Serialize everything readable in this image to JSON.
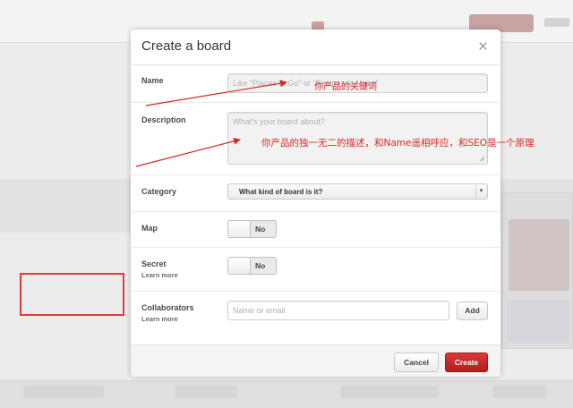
{
  "modal": {
    "title": "Create a board",
    "close_glyph": "×"
  },
  "form": {
    "name": {
      "label": "Name",
      "placeholder": "Like “Places to Go” or “Recipes to Make”"
    },
    "description": {
      "label": "Description",
      "placeholder": "What’s your board about?"
    },
    "category": {
      "label": "Category",
      "selected": "What kind of board is it?"
    },
    "map": {
      "label": "Map",
      "toggle": "No"
    },
    "secret": {
      "label": "Secret",
      "learn_more": "Learn more",
      "toggle": "No"
    },
    "collaborators": {
      "label": "Collaborators",
      "learn_more": "Learn more",
      "placeholder": "Name or email",
      "add_button": "Add"
    }
  },
  "footer": {
    "cancel_label": "Cancel",
    "create_label": "Create"
  },
  "annotations": {
    "name_note": "你产品的关键词",
    "description_note": "你产品的独一无二的描述，和Name遥相呼应，和SEO是一个原理"
  },
  "colors": {
    "accent_red": "#c62828",
    "annotation_red": "#d42a2a"
  },
  "icons": {
    "close": "close-icon",
    "dropdown": "chevron-down-icon",
    "resize": "resize-grip-icon"
  }
}
